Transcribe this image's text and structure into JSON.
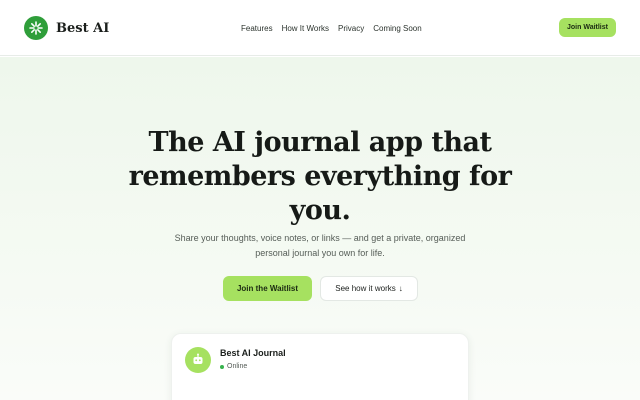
{
  "brand": {
    "name": "Best AI",
    "logo_icon": "sparkle-icon",
    "logo_color": "#2f9e3a"
  },
  "nav": {
    "items": [
      {
        "label": "Features"
      },
      {
        "label": "How It Works"
      },
      {
        "label": "Privacy"
      },
      {
        "label": "Coming Soon"
      }
    ],
    "cta_label": "Join Waitlist"
  },
  "hero": {
    "title": "The AI journal app that remembers everything for you.",
    "subtitle": "Share your thoughts, voice notes, or links — and get a private, organized personal journal you own for life.",
    "primary_cta": "Join the Waitlist",
    "secondary_cta": "See how it works",
    "secondary_cta_icon": "arrow-down-icon"
  },
  "chat_card": {
    "name": "Best AI Journal",
    "status": "Online",
    "avatar_icon": "robot-icon",
    "status_color": "#37b24d"
  },
  "colors": {
    "accent": "#a6e160",
    "brand_green": "#2f9e3a",
    "hero_bg": "#eef7ec"
  }
}
